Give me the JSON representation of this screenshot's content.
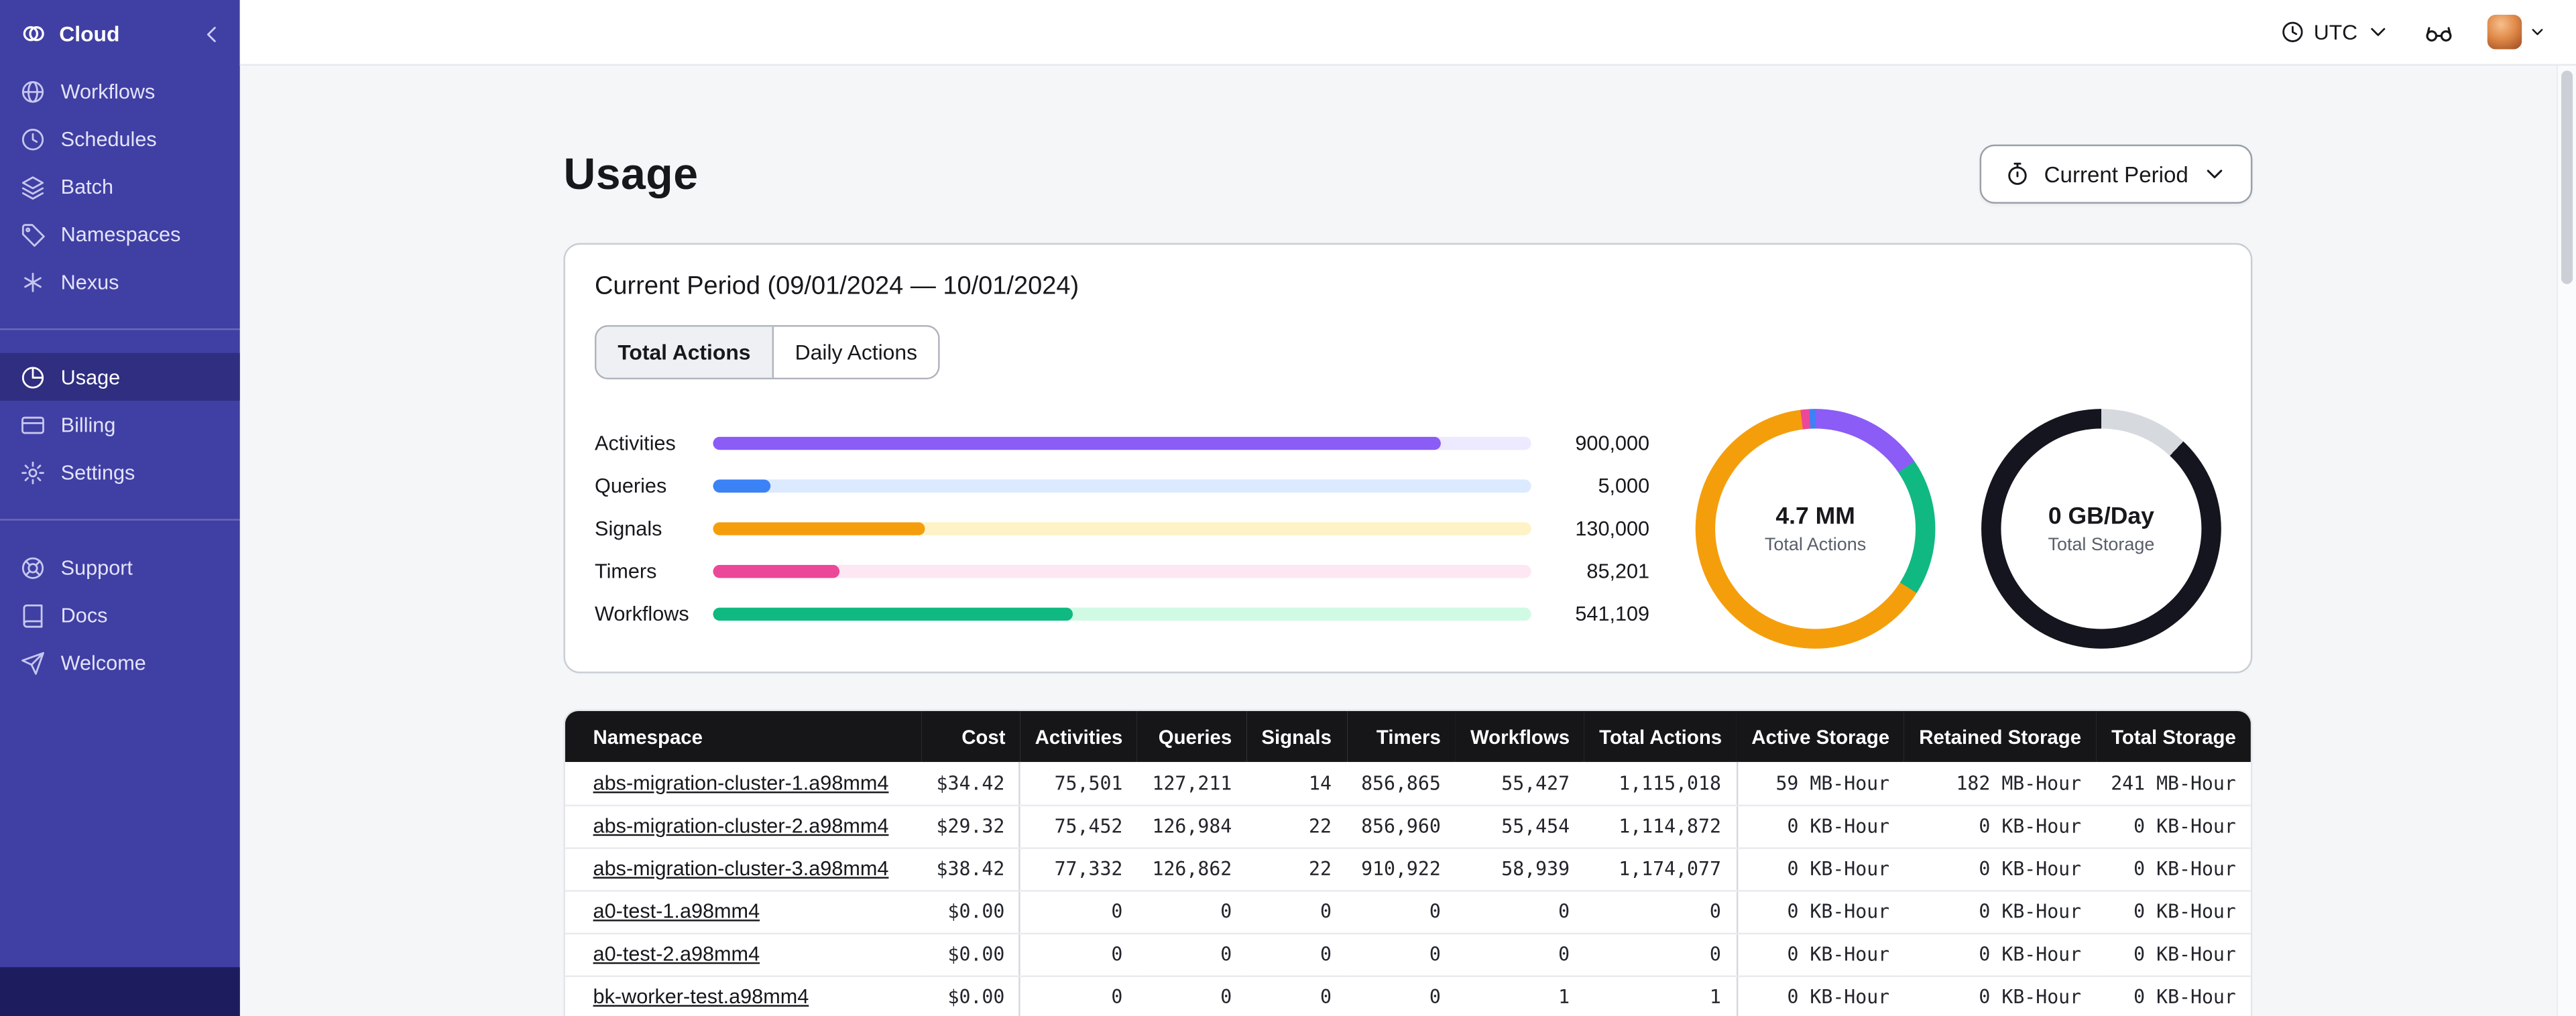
{
  "sidebar": {
    "brand": {
      "label": "Cloud",
      "icon": "temporal-logo-icon"
    },
    "nav_main": [
      {
        "label": "Workflows",
        "icon": "workflows-icon"
      },
      {
        "label": "Schedules",
        "icon": "schedules-icon"
      },
      {
        "label": "Batch",
        "icon": "batch-icon"
      },
      {
        "label": "Namespaces",
        "icon": "namespaces-icon"
      },
      {
        "label": "Nexus",
        "icon": "nexus-icon"
      }
    ],
    "nav_account": [
      {
        "label": "Usage",
        "icon": "usage-icon",
        "active": true
      },
      {
        "label": "Billing",
        "icon": "billing-icon"
      },
      {
        "label": "Settings",
        "icon": "settings-icon"
      }
    ],
    "nav_help": [
      {
        "label": "Support",
        "icon": "support-icon"
      },
      {
        "label": "Docs",
        "icon": "docs-icon"
      },
      {
        "label": "Welcome",
        "icon": "welcome-icon"
      }
    ]
  },
  "topbar": {
    "timezone": "UTC"
  },
  "page": {
    "title": "Usage",
    "period_button": "Current Period"
  },
  "usage_card": {
    "title": "Current Period (09/01/2024 — 10/01/2024)",
    "tabs": [
      {
        "label": "Total Actions",
        "active": true
      },
      {
        "label": "Daily Actions",
        "active": false
      }
    ]
  },
  "chart_data": [
    {
      "type": "bar",
      "orientation": "horizontal",
      "categories": [
        "Activities",
        "Queries",
        "Signals",
        "Timers",
        "Workflows"
      ],
      "values": [
        900000,
        5000,
        130000,
        85201,
        541109
      ],
      "display_values": [
        "900,000",
        "5,000",
        "130,000",
        "85,201",
        "541,109"
      ],
      "percent_fill": [
        89,
        7,
        26,
        15.5,
        44
      ],
      "colors": [
        "#8b5cf6",
        "#3b82f6",
        "#f59e0b",
        "#ec4899",
        "#10b981"
      ],
      "track_colors": [
        "#ede9fe",
        "#dbeafe",
        "#fef3c7",
        "#fce7f3",
        "#d1fae5"
      ]
    },
    {
      "type": "pie",
      "title": "Total Actions",
      "center_value": "4.7 MM",
      "segments": [
        {
          "label": "purple",
          "color": "#8b5cf6",
          "pct": 15.5
        },
        {
          "label": "green",
          "color": "#10b981",
          "pct": 18.5
        },
        {
          "label": "orange",
          "color": "#f59e0b",
          "pct": 64
        },
        {
          "label": "pink",
          "color": "#ec4899",
          "pct": 1.2
        },
        {
          "label": "blue",
          "color": "#3b82f6",
          "pct": 0.8
        }
      ]
    },
    {
      "type": "pie",
      "title": "Total Storage",
      "center_value": "0 GB/Day",
      "segments": [
        {
          "label": "gray",
          "color": "#d6d9de",
          "pct": 12
        },
        {
          "label": "dark",
          "color": "#15151f",
          "pct": 88
        }
      ]
    }
  ],
  "table": {
    "columns": [
      {
        "label": "Namespace",
        "align": "left"
      },
      {
        "label": "Cost",
        "align": "right",
        "group_end": true
      },
      {
        "label": "Activities",
        "align": "right"
      },
      {
        "label": "Queries",
        "align": "right"
      },
      {
        "label": "Signals",
        "align": "right"
      },
      {
        "label": "Timers",
        "align": "right"
      },
      {
        "label": "Workflows",
        "align": "right"
      },
      {
        "label": "Total Actions",
        "align": "right",
        "group_end": true
      },
      {
        "label": "Active Storage",
        "align": "right"
      },
      {
        "label": "Retained Storage",
        "align": "right"
      },
      {
        "label": "Total Storage",
        "align": "right"
      }
    ],
    "rows": [
      {
        "namespace": "abs-migration-cluster-1.a98mm4",
        "cells": [
          "$34.42",
          "75,501",
          "127,211",
          "14",
          "856,865",
          "55,427",
          "1,115,018",
          "59 MB-Hour",
          "182 MB-Hour",
          "241 MB-Hour"
        ]
      },
      {
        "namespace": "abs-migration-cluster-2.a98mm4",
        "cells": [
          "$29.32",
          "75,452",
          "126,984",
          "22",
          "856,960",
          "55,454",
          "1,114,872",
          "0 KB-Hour",
          "0 KB-Hour",
          "0 KB-Hour"
        ]
      },
      {
        "namespace": "abs-migration-cluster-3.a98mm4",
        "cells": [
          "$38.42",
          "77,332",
          "126,862",
          "22",
          "910,922",
          "58,939",
          "1,174,077",
          "0 KB-Hour",
          "0 KB-Hour",
          "0 KB-Hour"
        ]
      },
      {
        "namespace": "a0-test-1.a98mm4",
        "cells": [
          "$0.00",
          "0",
          "0",
          "0",
          "0",
          "0",
          "0",
          "0 KB-Hour",
          "0 KB-Hour",
          "0 KB-Hour"
        ]
      },
      {
        "namespace": "a0-test-2.a98mm4",
        "cells": [
          "$0.00",
          "0",
          "0",
          "0",
          "0",
          "0",
          "0",
          "0 KB-Hour",
          "0 KB-Hour",
          "0 KB-Hour"
        ]
      },
      {
        "namespace": "bk-worker-test.a98mm4",
        "cells": [
          "$0.00",
          "0",
          "0",
          "0",
          "0",
          "1",
          "1",
          "0 KB-Hour",
          "0 KB-Hour",
          "0 KB-Hour"
        ]
      }
    ]
  }
}
